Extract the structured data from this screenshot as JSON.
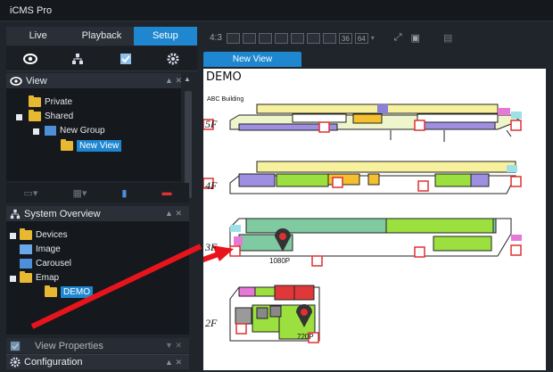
{
  "app": {
    "title": "iCMS Pro"
  },
  "tabs": [
    {
      "label": "Live"
    },
    {
      "label": "Playback"
    },
    {
      "label": "Setup"
    }
  ],
  "view_panel": {
    "title": "View",
    "tree": [
      {
        "label": "Private"
      },
      {
        "label": "Shared"
      },
      {
        "label": "New Group"
      },
      {
        "label": "New View"
      }
    ]
  },
  "system_overview": {
    "title": "System Overview",
    "tree": [
      {
        "label": "Devices"
      },
      {
        "label": "Image"
      },
      {
        "label": "Carousel"
      },
      {
        "label": "Emap"
      },
      {
        "label": "DEMO"
      }
    ]
  },
  "bottom_panels": {
    "view_properties": "View Properties",
    "configuration": "Configuration"
  },
  "toolbar": {
    "ratio": "4:3",
    "grid_36": "36",
    "grid_64": "64"
  },
  "view_tab": {
    "label": "New View"
  },
  "emap": {
    "title": "DEMO",
    "building": "ABC Building",
    "floors": [
      {
        "label": "5F"
      },
      {
        "label": "4F"
      },
      {
        "label": "3F"
      },
      {
        "label": "2F"
      }
    ],
    "camera_labels": [
      "1080P",
      "720P"
    ]
  },
  "colors": {
    "accent": "#1e87d0",
    "arrow": "#e8141c"
  }
}
